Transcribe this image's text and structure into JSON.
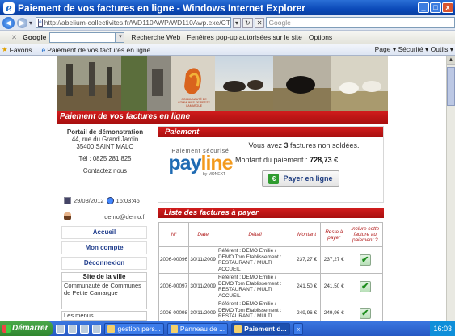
{
  "window": {
    "title": "Paiement de vos factures en ligne - Windows Internet Explorer",
    "min": "_",
    "max": "□",
    "close": "x"
  },
  "address": {
    "url": "http://abelium-collectivites.fr/WD110AWP/WD110Awp.exe/CT",
    "search_placeholder": "Google"
  },
  "toolbar": {
    "google": "Google",
    "search_web": "Recherche Web",
    "popups": "Fenêtres pop-up autorisées sur le site",
    "options": "Options"
  },
  "favorites": {
    "label": "Favoris",
    "tab": "Paiement de vos factures en ligne",
    "commands": "Page ▾  Sécurité ▾  Outils ▾"
  },
  "page": {
    "header_title": "Paiement de vos factures en ligne",
    "logo_text": "COMMUNAUTÉ DE COMMUNES DE PETITE CAMARGUE",
    "address": {
      "name": "Portail de démonstration",
      "street": "44, rue du Grand Jardin",
      "city": "35400 SAINT MALO",
      "tel": "Tél : 0825 281 825",
      "contact": "Contactez nous"
    },
    "date": "29/08/2012",
    "time": "16:03:46",
    "user": "demo@demo.fr",
    "menu": [
      "Accueil",
      "Mon compte",
      "Déconnexion"
    ],
    "site": {
      "title": "Site de la ville",
      "body": "Communauté de Communes de Petite Camargue",
      "footer": "Les menus"
    },
    "payment": {
      "title": "Paiement",
      "message_pre": "Vous avez ",
      "count": "3",
      "message_post": " factures non soldées.",
      "amount_label": "Montant du paiement : ",
      "amount": "728,73 €",
      "button": "Payer en ligne",
      "logo_small": "Paiement sécurisé",
      "logo_big_a": "pay",
      "logo_big_b": "line",
      "logo_by": "by MONEXT"
    },
    "invoices": {
      "title": "Liste des factures à payer",
      "headers": [
        "N°",
        "Date",
        "Détail",
        "Montant",
        "Reste à payer",
        "Inclure cette facture au paiement ?"
      ],
      "rows": [
        {
          "num": "2006-00096",
          "date": "30/11/2009",
          "detail": "Référent : DEMO Emilie / DEMO Tom Etablissement : RESTAURANT / MULTI ACCUEIL",
          "montant": "237,27 €",
          "reste": "237,27 €"
        },
        {
          "num": "2006-00097",
          "date": "30/11/2009",
          "detail": "Référent : DEMO Emilie / DEMO Tom Etablissement : RESTAURANT / MULTI ACCUEIL",
          "montant": "241,50 €",
          "reste": "241,50 €"
        },
        {
          "num": "2006-00098",
          "date": "30/11/2009",
          "detail": "Référent : DEMO Emilie / DEMO Tom Etablissement : RESTAURANT / MULTI ACCUEIL",
          "montant": "249,96 €",
          "reste": "249,96 €"
        }
      ]
    }
  },
  "taskbar": {
    "start": "Démarrer",
    "tasks": [
      "gestion pers...",
      "Panneau de ...",
      "Paiement d...",
      "«"
    ],
    "clock": "16:03"
  },
  "colors": {
    "accent_red": "#c41414",
    "title_blue": "#0b49b8",
    "link_blue": "#23408e"
  }
}
